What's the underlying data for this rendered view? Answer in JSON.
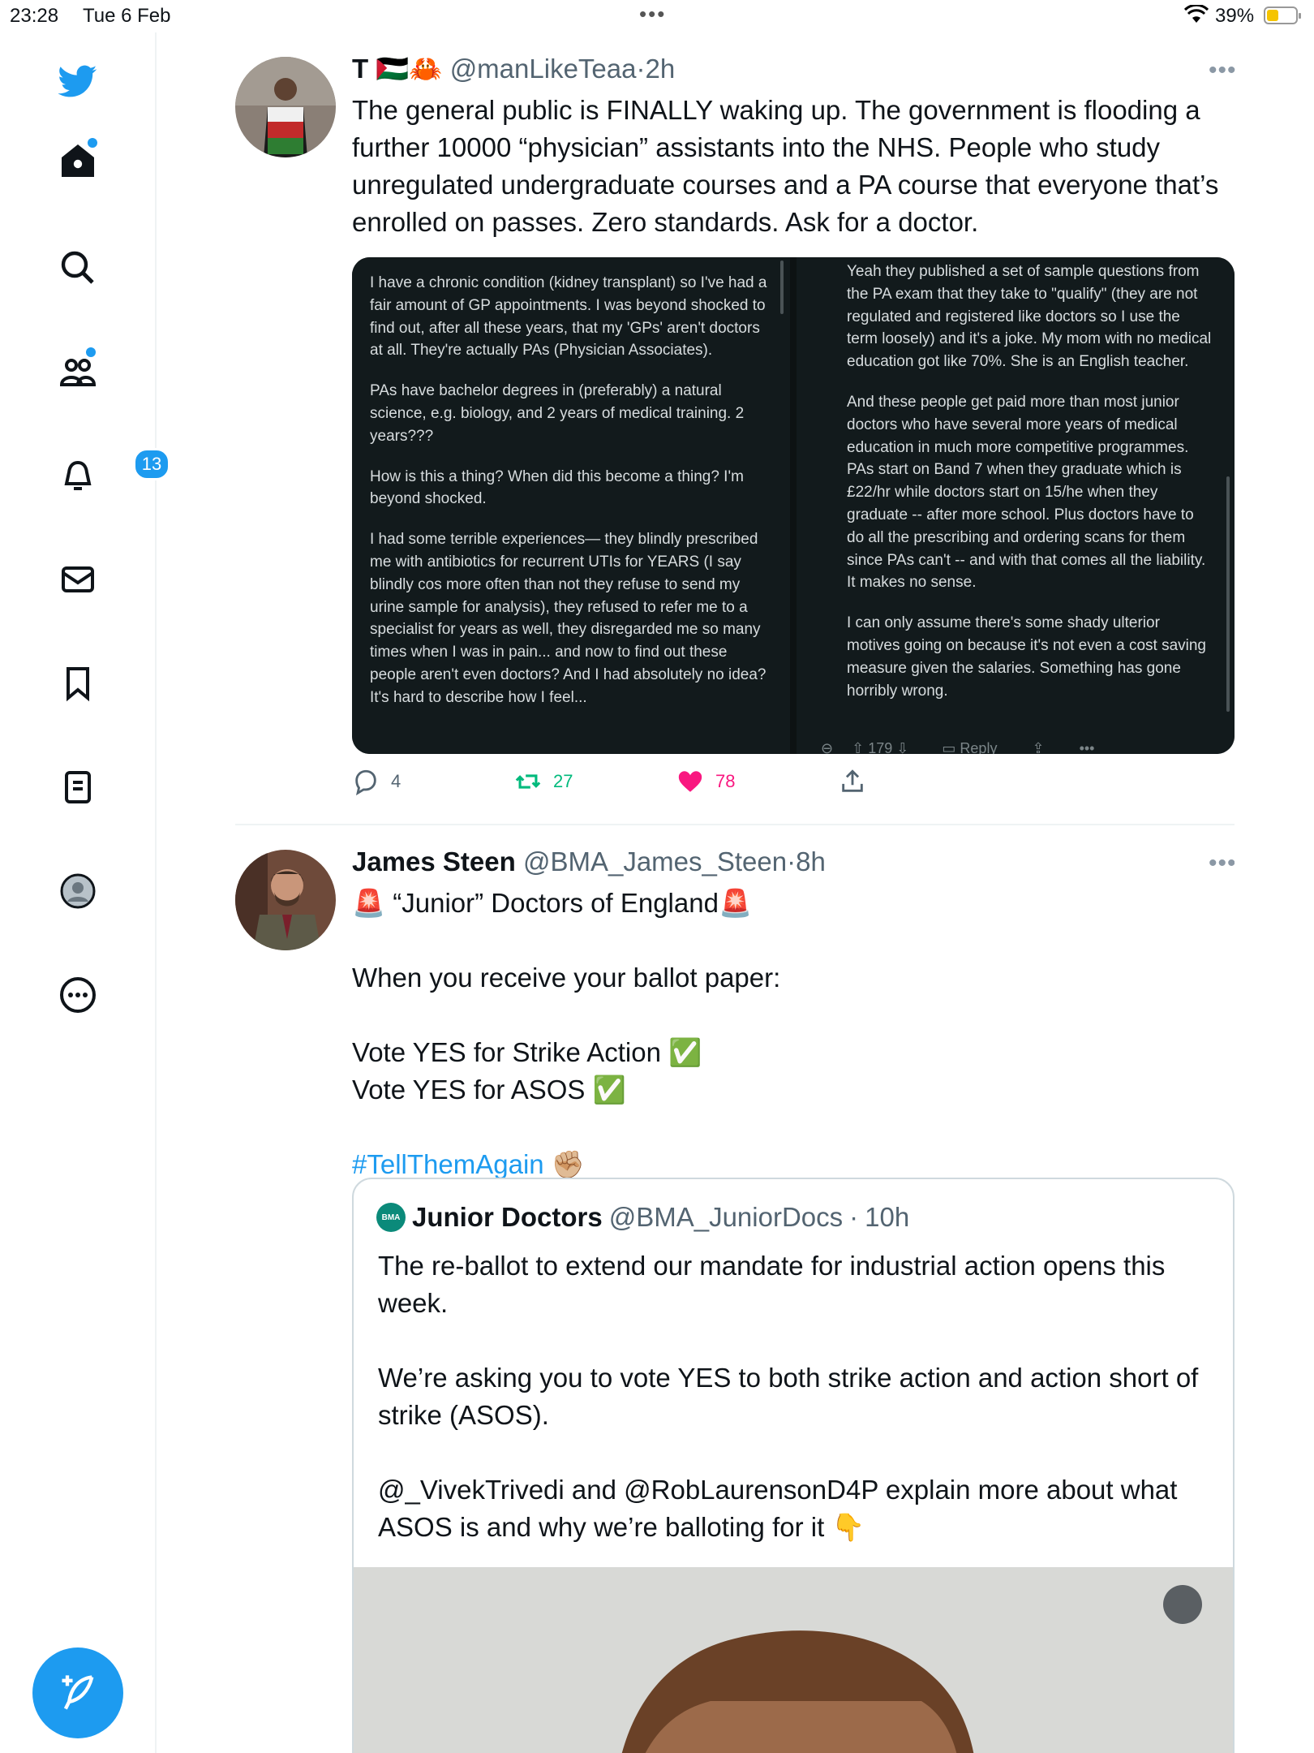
{
  "status_bar": {
    "time": "23:28",
    "date": "Tue 6 Feb",
    "dots": "•••",
    "battery_percent": "39%",
    "battery_level": 0.39
  },
  "sidebar": {
    "notifications_badge": "13",
    "colors": {
      "accent": "#1d9bf0"
    }
  },
  "tweet1": {
    "name": "T 🇵🇸🦀",
    "handle": "@manLikeTeaa",
    "sep": "·",
    "time": "2h",
    "more": "•••",
    "text": "The general public is FINALLY waking up. The government is flooding a further 10000 “physician” assistants into the NHS. People who study unregulated undergraduate courses and a PA course that everyone that’s enrolled on passes. Zero standards. Ask for a doctor.",
    "left_panel_paragraphs": [
      "I have a chronic condition (kidney transplant) so I've had a fair amount of GP appointments. I was beyond shocked to find out, after all these years, that my 'GPs' aren't doctors at all. They're actually PAs (Physician Associates).",
      "PAs have bachelor degrees in (preferably) a natural science, e.g. biology, and 2 years of medical training. 2 years???",
      "How is this a thing? When did this become a thing? I'm beyond shocked.",
      "I had some terrible experiences— they blindly prescribed me with antibiotics for recurrent UTIs for YEARS (I say blindly cos more often than not they refuse to send my urine sample for analysis), they refused to refer me to a specialist for years as well, they disregarded me so many times when I was in pain... and now to find out these people aren't even doctors? And I had absolutely no idea? It's hard to describe how I feel..."
    ],
    "right_panel_paragraphs": [
      "Yeah they published a set of sample questions from the PA exam that they take to \"qualify\" (they are not regulated and registered like doctors so I use the term loosely) and it's a joke. My mom with no medical education got like 70%. She is an English teacher.",
      "And these people get paid more than most junior doctors who have several more years of medical education in much more competitive programmes. PAs start on Band 7 when they graduate which is £22/hr while doctors start on 15/he when they graduate -- after more school. Plus doctors have to do all the prescribing and ordering scans for them since PAs can't -- and with that comes all the liability. It makes no sense.",
      "I can only assume there's some shady ulterior motives going on because it's not even a cost saving measure given the salaries. Something has gone horribly wrong."
    ],
    "right_panel_votes": "179",
    "right_panel_reply": "Reply",
    "right_panel_more": "•••",
    "replies": "4",
    "retweets": "27",
    "likes": "78",
    "colors": {
      "retweet": "#00ba7c",
      "like": "#f91880"
    }
  },
  "tweet2": {
    "name": "James Steen",
    "handle": "@BMA_James_Steen",
    "sep": "·",
    "time": "8h",
    "more": "•••",
    "line1": "🚨 “Junior” Doctors of England🚨",
    "line2": "When you receive your ballot paper:",
    "line3": "Vote YES for Strike Action ✅",
    "line4": "Vote YES for ASOS ✅",
    "hashtag": "#TellThemAgain",
    "hashtag_emoji": " ✊🏼",
    "quote": {
      "logo": "BMA",
      "name": "Junior Doctors",
      "handle": "@BMA_JuniorDocs",
      "sep": "·",
      "time": "10h",
      "p1": "The re-ballot to extend our mandate for industrial action opens this week.",
      "p2": "We’re asking you to vote YES to both strike action and action short of strike (ASOS).",
      "p3": "@_VivekTrivedi and @RobLaurensonD4P explain more about what ASOS is and why we’re balloting for it 👇"
    }
  }
}
